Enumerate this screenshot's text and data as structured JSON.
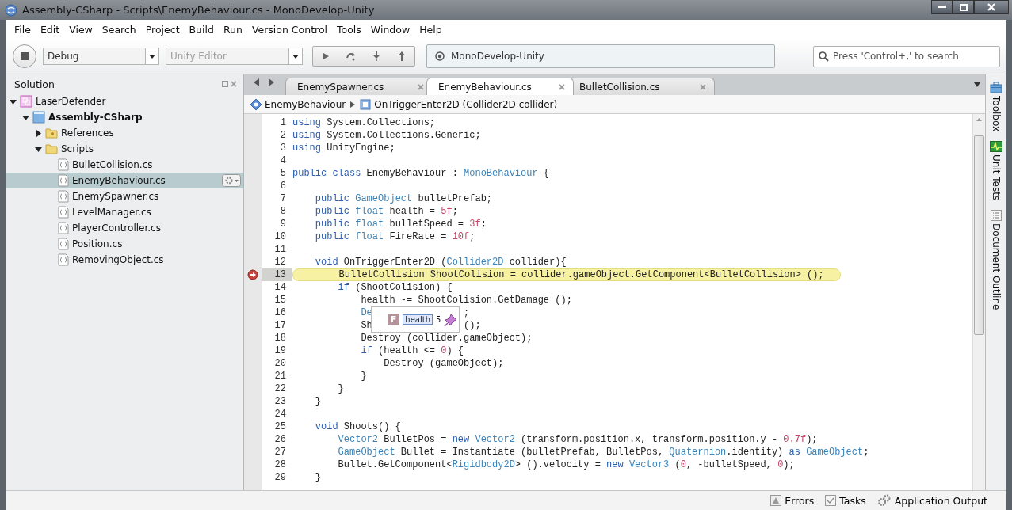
{
  "window": {
    "title": "Assembly-CSharp - Scripts\\EnemyBehaviour.cs - MonoDevelop-Unity"
  },
  "menu": [
    "File",
    "Edit",
    "View",
    "Search",
    "Project",
    "Build",
    "Run",
    "Version Control",
    "Tools",
    "Window",
    "Help"
  ],
  "toolbar": {
    "configuration": {
      "value": "Debug",
      "disabled": false
    },
    "target": {
      "value": "Unity Editor",
      "disabled": true
    },
    "status": "MonoDevelop-Unity",
    "search": {
      "placeholder": "Press 'Control+,' to search"
    }
  },
  "solution": {
    "title": "Solution",
    "tree": [
      {
        "label": "LaserDefender",
        "kind": "solution",
        "expanded": true,
        "selected": false,
        "startup": false,
        "children": [
          {
            "label": "Assembly-CSharp",
            "kind": "project",
            "expanded": true,
            "selected": false,
            "startup": true,
            "children": [
              {
                "label": "References",
                "kind": "references",
                "expanded": false,
                "selected": false,
                "startup": false
              },
              {
                "label": "Scripts",
                "kind": "folder",
                "expanded": true,
                "selected": false,
                "startup": false,
                "children": [
                  {
                    "label": "BulletCollision.cs",
                    "kind": "file",
                    "selected": false,
                    "startup": false
                  },
                  {
                    "label": "EnemyBehaviour.cs",
                    "kind": "file",
                    "selected": true,
                    "startup": false
                  },
                  {
                    "label": "EnemySpawner.cs",
                    "kind": "file",
                    "selected": false,
                    "startup": false
                  },
                  {
                    "label": "LevelManager.cs",
                    "kind": "file",
                    "selected": false,
                    "startup": false
                  },
                  {
                    "label": "PlayerController.cs",
                    "kind": "file",
                    "selected": false,
                    "startup": false
                  },
                  {
                    "label": "Position.cs",
                    "kind": "file",
                    "selected": false,
                    "startup": false
                  },
                  {
                    "label": "RemovingObject.cs",
                    "kind": "file",
                    "selected": false,
                    "startup": false
                  }
                ]
              }
            ]
          }
        ]
      }
    ]
  },
  "tabs": [
    {
      "label": "EnemySpawner.cs",
      "selected": false
    },
    {
      "label": "EnemyBehaviour.cs",
      "selected": true
    },
    {
      "label": "BulletCollision.cs",
      "selected": false
    }
  ],
  "breadcrumb": {
    "class": "EnemyBehaviour",
    "member": "OnTriggerEnter2D (Collider2D collider)"
  },
  "code": [
    {
      "number": "1",
      "current": false,
      "breakpoint": false,
      "tokens": [
        {
          "kind": "keyword",
          "text": "using"
        },
        {
          "kind": "plain",
          "text": " System.Collections;"
        }
      ]
    },
    {
      "number": "2",
      "current": false,
      "breakpoint": false,
      "tokens": [
        {
          "kind": "keyword",
          "text": "using"
        },
        {
          "kind": "plain",
          "text": " System.Collections.Generic;"
        }
      ]
    },
    {
      "number": "3",
      "current": false,
      "breakpoint": false,
      "tokens": [
        {
          "kind": "keyword",
          "text": "using"
        },
        {
          "kind": "plain",
          "text": " UnityEngine;"
        }
      ]
    },
    {
      "number": "4",
      "current": false,
      "breakpoint": false
    },
    {
      "number": "5",
      "current": false,
      "breakpoint": false,
      "tokens": [
        {
          "kind": "keyword",
          "text": "public class"
        },
        {
          "kind": "plain",
          "text": " EnemyBehaviour : "
        },
        {
          "kind": "type",
          "text": "MonoBehaviour"
        },
        {
          "kind": "plain",
          "text": " {"
        }
      ]
    },
    {
      "number": "6",
      "current": false,
      "breakpoint": false
    },
    {
      "number": "7",
      "current": false,
      "breakpoint": false,
      "tokens": [
        {
          "kind": "keyword",
          "text": "    public "
        },
        {
          "kind": "type",
          "text": "GameObject"
        },
        {
          "kind": "plain",
          "text": " bulletPrefab;"
        }
      ]
    },
    {
      "number": "8",
      "current": false,
      "breakpoint": false,
      "tokens": [
        {
          "kind": "keyword",
          "text": "    public "
        },
        {
          "kind": "type",
          "text": "float"
        },
        {
          "kind": "plain",
          "text": " health = "
        },
        {
          "kind": "number",
          "text": "5f"
        },
        {
          "kind": "plain",
          "text": ";"
        }
      ]
    },
    {
      "number": "9",
      "current": false,
      "breakpoint": false,
      "tokens": [
        {
          "kind": "keyword",
          "text": "    public "
        },
        {
          "kind": "type",
          "text": "float"
        },
        {
          "kind": "plain",
          "text": " bulletSpeed = "
        },
        {
          "kind": "number",
          "text": "3f"
        },
        {
          "kind": "plain",
          "text": ";"
        }
      ]
    },
    {
      "number": "10",
      "current": false,
      "breakpoint": false,
      "tokens": [
        {
          "kind": "keyword",
          "text": "    public "
        },
        {
          "kind": "type",
          "text": "float"
        },
        {
          "kind": "plain",
          "text": " FireRate = "
        },
        {
          "kind": "number",
          "text": "10f"
        },
        {
          "kind": "plain",
          "text": ";"
        }
      ]
    },
    {
      "number": "11",
      "current": false,
      "breakpoint": false
    },
    {
      "number": "12",
      "current": false,
      "breakpoint": false,
      "tokens": [
        {
          "kind": "keyword",
          "text": "    void"
        },
        {
          "kind": "plain",
          "text": " OnTriggerEnter2D ("
        },
        {
          "kind": "type",
          "text": "Collider2D"
        },
        {
          "kind": "plain",
          "text": " collider){"
        }
      ]
    },
    {
      "number": "13",
      "current": true,
      "breakpoint": true,
      "tokens": [
        {
          "kind": "plain",
          "text": "        BulletCollision ShootColision = collider.gameObject.GetComponent<BulletCollision> ();"
        }
      ]
    },
    {
      "number": "14",
      "current": false,
      "breakpoint": false,
      "tokens": [
        {
          "kind": "keyword",
          "text": "        if"
        },
        {
          "kind": "plain",
          "text": " (ShootColision) {"
        }
      ]
    },
    {
      "number": "15",
      "current": false,
      "breakpoint": false,
      "tokens": [
        {
          "kind": "plain",
          "text": "            health -= ShootColision.GetDamage ();"
        }
      ]
    },
    {
      "number": "16",
      "current": false,
      "breakpoint": false,
      "tokens": [
        {
          "kind": "type",
          "text": "            De"
        }
      ],
      "after_popup": ";"
    },
    {
      "number": "17",
      "current": false,
      "breakpoint": false,
      "tokens": [
        {
          "kind": "plain",
          "text": "            Sh"
        }
      ],
      "after_popup": "();"
    },
    {
      "number": "18",
      "current": false,
      "breakpoint": false,
      "tokens": [
        {
          "kind": "plain",
          "text": "            Destroy (collider.gameObject);"
        }
      ]
    },
    {
      "number": "19",
      "current": false,
      "breakpoint": false,
      "tokens": [
        {
          "kind": "keyword",
          "text": "            if"
        },
        {
          "kind": "plain",
          "text": " (health <= "
        },
        {
          "kind": "number",
          "text": "0"
        },
        {
          "kind": "plain",
          "text": ") {"
        }
      ]
    },
    {
      "number": "20",
      "current": false,
      "breakpoint": false,
      "tokens": [
        {
          "kind": "plain",
          "text": "                Destroy (gameObject);"
        }
      ]
    },
    {
      "number": "21",
      "current": false,
      "breakpoint": false,
      "tokens": [
        {
          "kind": "plain",
          "text": "            }"
        }
      ]
    },
    {
      "number": "22",
      "current": false,
      "breakpoint": false,
      "tokens": [
        {
          "kind": "plain",
          "text": "        }"
        }
      ]
    },
    {
      "number": "23",
      "current": false,
      "breakpoint": false,
      "tokens": [
        {
          "kind": "plain",
          "text": "    }"
        }
      ]
    },
    {
      "number": "24",
      "current": false,
      "breakpoint": false
    },
    {
      "number": "25",
      "current": false,
      "breakpoint": false,
      "tokens": [
        {
          "kind": "keyword",
          "text": "    void"
        },
        {
          "kind": "plain",
          "text": " Shoots() {"
        }
      ]
    },
    {
      "number": "26",
      "current": false,
      "breakpoint": false,
      "tokens": [
        {
          "kind": "type",
          "text": "        Vector2"
        },
        {
          "kind": "plain",
          "text": " BulletPos = "
        },
        {
          "kind": "keyword",
          "text": "new "
        },
        {
          "kind": "type",
          "text": "Vector2"
        },
        {
          "kind": "plain",
          "text": " (transform.position.x, transform.position.y - "
        },
        {
          "kind": "number",
          "text": "0.7f"
        },
        {
          "kind": "plain",
          "text": ");"
        }
      ]
    },
    {
      "number": "27",
      "current": false,
      "breakpoint": false,
      "tokens": [
        {
          "kind": "type",
          "text": "        GameObject"
        },
        {
          "kind": "plain",
          "text": " Bullet = Instantiate (bulletPrefab, BulletPos, "
        },
        {
          "kind": "type",
          "text": "Quaternion"
        },
        {
          "kind": "plain",
          "text": ".identity) "
        },
        {
          "kind": "keyword",
          "text": "as "
        },
        {
          "kind": "type",
          "text": "GameObject"
        },
        {
          "kind": "plain",
          "text": ";"
        }
      ]
    },
    {
      "number": "28",
      "current": false,
      "breakpoint": false,
      "tokens": [
        {
          "kind": "plain",
          "text": "        Bullet.GetComponent<"
        },
        {
          "kind": "type",
          "text": "Rigidbody2D"
        },
        {
          "kind": "plain",
          "text": "> ().velocity = "
        },
        {
          "kind": "keyword",
          "text": "new "
        },
        {
          "kind": "type",
          "text": "Vector3"
        },
        {
          "kind": "plain",
          "text": " ("
        },
        {
          "kind": "number",
          "text": "0"
        },
        {
          "kind": "plain",
          "text": ", -bulletSpeed, "
        },
        {
          "kind": "number",
          "text": "0"
        },
        {
          "kind": "plain",
          "text": ");"
        }
      ]
    },
    {
      "number": "29",
      "current": false,
      "breakpoint": false,
      "tokens": [
        {
          "kind": "plain",
          "text": "    }"
        }
      ]
    }
  ],
  "popup": {
    "kind_letter": "F",
    "name": "health",
    "value": "5"
  },
  "side_pads": [
    {
      "label": "Toolbox",
      "kind": "toolbox"
    },
    {
      "label": "Unit Tests",
      "kind": "tests"
    },
    {
      "label": "Document Outline",
      "kind": "outline"
    }
  ],
  "status_bar": [
    {
      "label": "Errors",
      "kind": "errors"
    },
    {
      "label": "Tasks",
      "kind": "tasks"
    },
    {
      "label": "Application Output",
      "kind": "output"
    }
  ]
}
